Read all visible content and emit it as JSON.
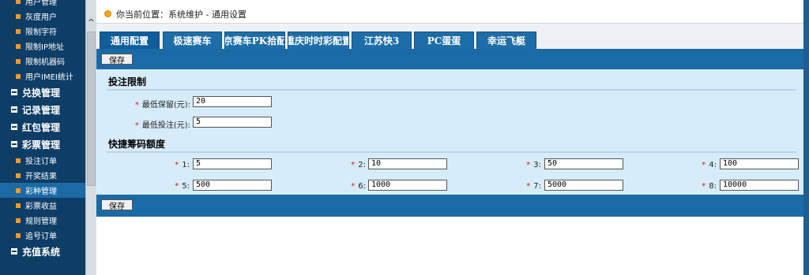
{
  "sidebar": {
    "items": [
      {
        "label": "用户管理",
        "kind": "item"
      },
      {
        "label": "灰度用户",
        "kind": "item"
      },
      {
        "label": "限制字符",
        "kind": "item"
      },
      {
        "label": "限制IP地址",
        "kind": "item"
      },
      {
        "label": "限制机器码",
        "kind": "item"
      },
      {
        "label": "用户IMEI统计",
        "kind": "item"
      },
      {
        "label": "兑换管理",
        "kind": "group"
      },
      {
        "label": "记录管理",
        "kind": "group"
      },
      {
        "label": "红包管理",
        "kind": "group"
      },
      {
        "label": "彩票管理",
        "kind": "group"
      },
      {
        "label": "投注订单",
        "kind": "item"
      },
      {
        "label": "开奖结果",
        "kind": "item"
      },
      {
        "label": "彩种管理",
        "kind": "item",
        "active": true
      },
      {
        "label": "彩票收益",
        "kind": "item"
      },
      {
        "label": "规则管理",
        "kind": "item"
      },
      {
        "label": "追号订单",
        "kind": "item"
      },
      {
        "label": "充值系统",
        "kind": "group"
      }
    ]
  },
  "breadcrumb": {
    "text": "你当前位置：系统维护 - 通用设置"
  },
  "tabs": [
    {
      "label": "通用配置",
      "active": true
    },
    {
      "label": "极速赛车"
    },
    {
      "label": "北京赛车PK拾配置"
    },
    {
      "label": "重庆时时彩配置"
    },
    {
      "label": "江苏快3"
    },
    {
      "label": "PC蛋蛋"
    },
    {
      "label": "幸运飞艇"
    }
  ],
  "toolbar": {
    "save_label": "保存"
  },
  "footer_toolbar": {
    "save_label": "保存"
  },
  "bet_limit": {
    "title": "投注限制",
    "min_keep_label": "最低保留(元):",
    "min_keep_value": "20",
    "min_bet_label": "最低投注(元):",
    "min_bet_value": "5"
  },
  "chips": {
    "title": "快捷筹码额度",
    "fields": [
      {
        "label": "1:",
        "value": "5"
      },
      {
        "label": "2:",
        "value": "10"
      },
      {
        "label": "3:",
        "value": "50"
      },
      {
        "label": "4:",
        "value": "100"
      },
      {
        "label": "5:",
        "value": "500"
      },
      {
        "label": "6:",
        "value": "1000"
      },
      {
        "label": "7:",
        "value": "5000"
      },
      {
        "label": "8:",
        "value": "10000"
      }
    ]
  },
  "colors": {
    "accent": "#1a6aa6",
    "sidebar_bg": "#0e3d66",
    "panel_bg": "#d7ecf9"
  }
}
